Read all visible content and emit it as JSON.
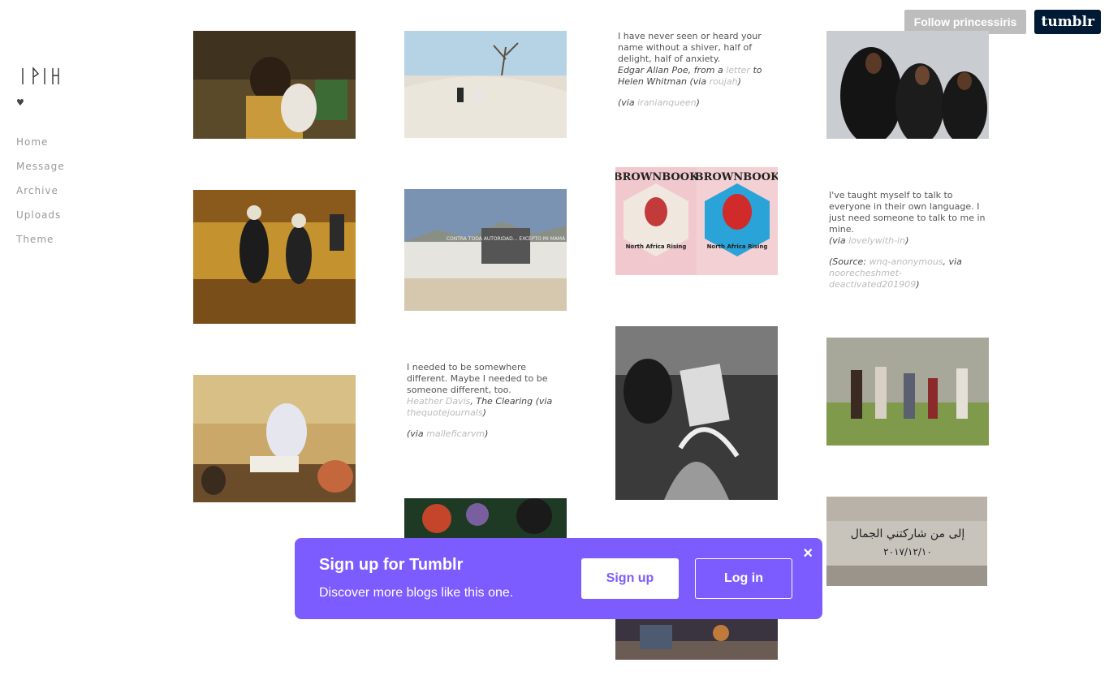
{
  "blog": {
    "heart": "♥"
  },
  "nav": [
    "Home",
    "Message",
    "Archive",
    "Uploads",
    "Theme"
  ],
  "topbar": {
    "follow": "Follow princessiris",
    "tumblr": "tumblr"
  },
  "posts": {
    "poe": {
      "text": "I have never seen or heard your name without a shiver, half of delight, half of anxiety.",
      "source_author": "Edgar Allan Poe, from a ",
      "source_link": "letter",
      "source_rest": " to Helen Whitman (via ",
      "source_via": "roujah",
      "close": ")",
      "via_prefix": "(via ",
      "via_user": "iranianqueen",
      "via_suffix": ")"
    },
    "language": {
      "text": "I've taught myself to talk to everyone in their own language. I just need someone to talk to me in mine.",
      "via_prefix": "(via ",
      "via_user": "lovelywith-in",
      "via_suffix": ")",
      "source_prefix": "(Source: ",
      "source_user": "wnq-anonymous",
      "source_mid": ", via ",
      "source_via": "noorecheshmet-deactivated201909",
      "source_suffix": ")"
    },
    "somewhere": {
      "text": "I needed to be somewhere different. Maybe I needed to be someone different, too.",
      "author": "Heather Davis",
      "sep": ", ",
      "book": "The Clearing (via ",
      "via1": "thequotejournals",
      "close": ")",
      "via_prefix": "(via ",
      "via_user": "malleficarvm",
      "via_suffix": ")"
    },
    "wall": {
      "graffiti": "CONTRA TODA AUTORIDAD... EXCEPTO MI MAMÁ"
    },
    "magazine": {
      "title": "BROWNBOOK",
      "subtitle": "North Africa Rising"
    },
    "arabic": {
      "text": "إلى من شاركتني الجمال",
      "date": "٢٠١٧/١٢/١٠"
    }
  },
  "banner": {
    "title": "Sign up for Tumblr",
    "subtitle": "Discover more blogs like this one.",
    "signup": "Sign up",
    "login": "Log in",
    "close": "×"
  }
}
